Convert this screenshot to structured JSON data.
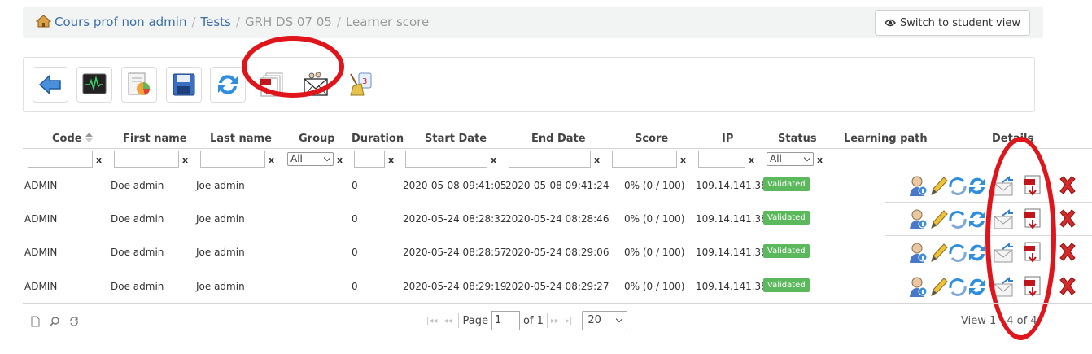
{
  "breadcrumb": {
    "items": [
      "Cours prof non admin",
      "Tests",
      "GRH DS 07 05",
      "Learner score"
    ],
    "separator": "/"
  },
  "switch_button": {
    "label": "Switch to student view",
    "icon": "eye-icon"
  },
  "toolbar": {
    "buttons": [
      {
        "icon": "back-arrow-icon"
      },
      {
        "icon": "activity-monitor-icon"
      },
      {
        "icon": "reports-chart-icon"
      },
      {
        "icon": "save-floppy-icon"
      },
      {
        "icon": "refresh-icon"
      },
      {
        "icon": "pdf-export-icon"
      },
      {
        "icon": "send-email-icon"
      },
      {
        "icon": "clean-broom-icon"
      }
    ]
  },
  "table": {
    "columns": [
      "Code",
      "First name",
      "Last name",
      "Group",
      "Duration",
      "Start Date",
      "End Date",
      "Score",
      "IP",
      "Status",
      "Learning path",
      "Details"
    ],
    "filter_clear": "x",
    "group_filter": "All",
    "status_filter": "All",
    "rows": [
      {
        "code": "ADMIN",
        "first": "Doe admin",
        "last": "Joe admin",
        "group": "",
        "duration": "0",
        "start": "2020-05-08 09:41:05",
        "end": "2020-05-08 09:41:24",
        "score": "0% (0 / 100)",
        "ip": "109.14.141.38",
        "status": "Validated"
      },
      {
        "code": "ADMIN",
        "first": "Doe admin",
        "last": "Joe admin",
        "group": "",
        "duration": "0",
        "start": "2020-05-24 08:28:32",
        "end": "2020-05-24 08:28:46",
        "score": "0% (0 / 100)",
        "ip": "109.14.141.38",
        "status": "Validated"
      },
      {
        "code": "ADMIN",
        "first": "Doe admin",
        "last": "Joe admin",
        "group": "",
        "duration": "0",
        "start": "2020-05-24 08:28:57",
        "end": "2020-05-24 08:29:06",
        "score": "0% (0 / 100)",
        "ip": "109.14.141.38",
        "status": "Validated"
      },
      {
        "code": "ADMIN",
        "first": "Doe admin",
        "last": "Joe admin",
        "group": "",
        "duration": "0",
        "start": "2020-05-24 08:29:19",
        "end": "2020-05-24 08:29:27",
        "score": "0% (0 / 100)",
        "ip": "109.14.141.38",
        "status": "Validated"
      }
    ],
    "row_actions": [
      "user-info-icon",
      "edit-pencil-icon",
      "learning-path-icon",
      "refresh-icon",
      "send-mail-icon",
      "pdf-download-icon",
      "delete-icon"
    ]
  },
  "pager": {
    "page_label": "Page",
    "page_value": "1",
    "of_label": "of 1",
    "rows_per_page": "20",
    "view_info": "View 1 - 4 of 4"
  },
  "colors": {
    "link": "#3a6ea5",
    "badge_green": "#5cb85c",
    "annotation_red": "#e0151c"
  }
}
